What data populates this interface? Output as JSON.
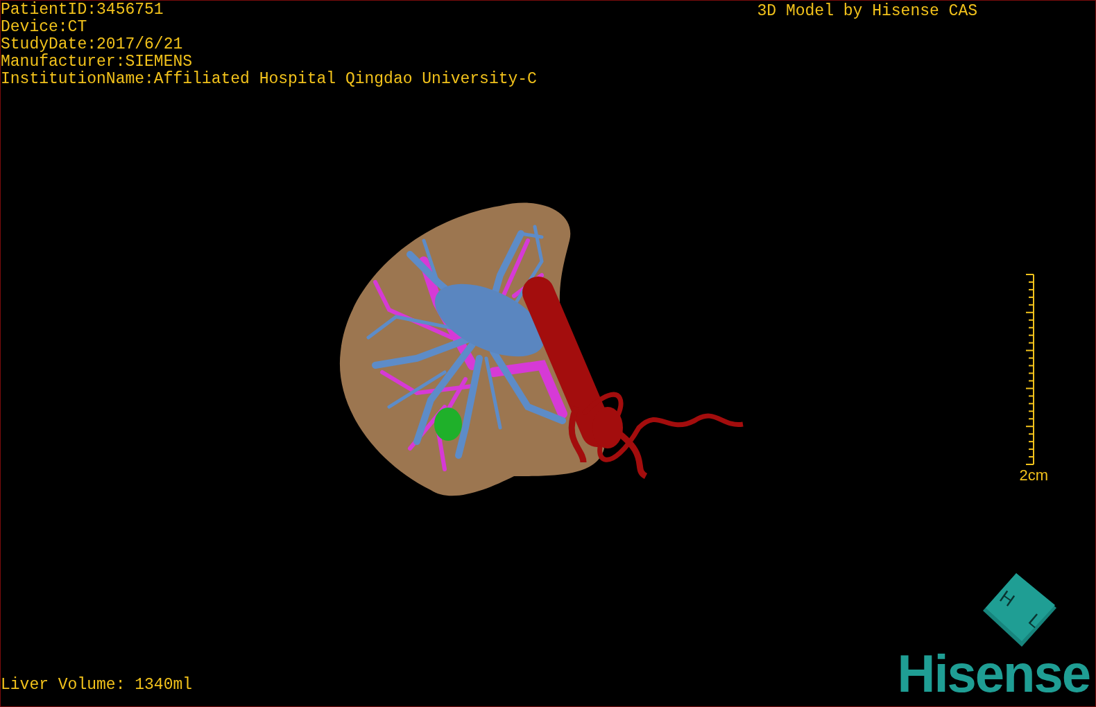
{
  "info_lines": [
    "PatientID:3456751",
    "Device:CT",
    "StudyDate:2017/6/21",
    "Manufacturer:SIEMENS",
    "InstitutionName:Affiliated Hospital Qingdao University-C"
  ],
  "title": "3D Model by Hisense CAS",
  "scale_bar": {
    "label": "2cm"
  },
  "orientation_cube": {
    "faces": [
      "H",
      "L"
    ]
  },
  "liver_volume": "Liver Volume: 1340ml",
  "logo": "Hisense"
}
